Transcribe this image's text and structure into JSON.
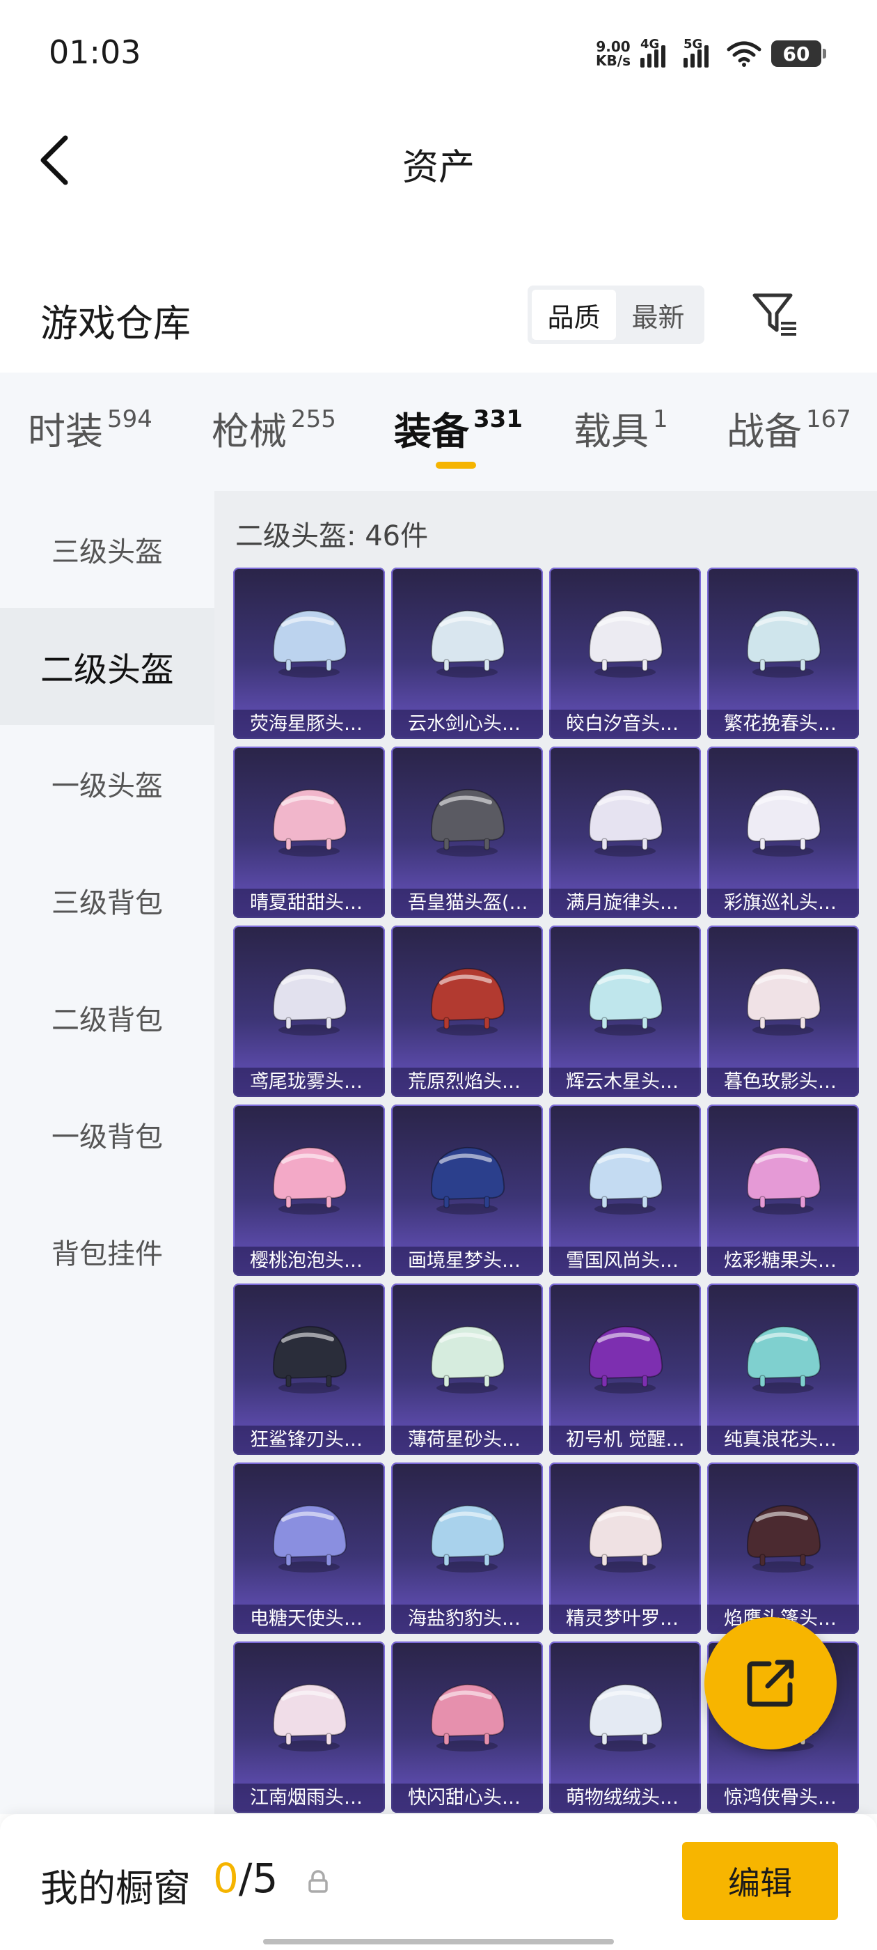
{
  "status": {
    "time": "01:03",
    "netspeed_value": "9.00",
    "netspeed_unit": "KB/s",
    "sig1": "4G",
    "sig2": "5G",
    "battery": "60"
  },
  "nav": {
    "title": "资产"
  },
  "warehouse": {
    "title": "游戏仓库",
    "sort_options": [
      "品质",
      "最新"
    ],
    "sort_selected": "品质"
  },
  "tabs": [
    {
      "label": "时装",
      "count": "594"
    },
    {
      "label": "枪械",
      "count": "255"
    },
    {
      "label": "装备",
      "count": "331",
      "active": true
    },
    {
      "label": "载具",
      "count": "1"
    },
    {
      "label": "战备",
      "count": "167"
    }
  ],
  "sidebar": {
    "items": [
      "三级头盔",
      "二级头盔",
      "一级头盔",
      "三级背包",
      "二级背包",
      "一级背包",
      "背包挂件"
    ],
    "active": "二级头盔"
  },
  "content": {
    "header": "二级头盔: 46件"
  },
  "items": [
    {
      "name": "荧海星豚头…",
      "color": "#bcd3ee"
    },
    {
      "name": "云水剑心头…",
      "color": "#d9e6ef"
    },
    {
      "name": "皎白汐音头…",
      "color": "#ecebf2"
    },
    {
      "name": "繁花挽春头…",
      "color": "#cfe5ec"
    },
    {
      "name": "晴夏甜甜头…",
      "color": "#f1b6cb"
    },
    {
      "name": "吾皇猫头盔(…",
      "color": "#5a5a62"
    },
    {
      "name": "满月旋律头…",
      "color": "#e6e3f1"
    },
    {
      "name": "彩旗巡礼头…",
      "color": "#eeecf5"
    },
    {
      "name": "鸢尾珑雾头…",
      "color": "#e2e1ee"
    },
    {
      "name": "荒原烈焰头…",
      "color": "#b23a30"
    },
    {
      "name": "辉云木星头…",
      "color": "#bfe6ec"
    },
    {
      "name": "暮色玫影头…",
      "color": "#f0e2e6"
    },
    {
      "name": "樱桃泡泡头…",
      "color": "#f3a9c7"
    },
    {
      "name": "画境星梦头…",
      "color": "#2b3f8c"
    },
    {
      "name": "雪国风尚头…",
      "color": "#c4dbf2"
    },
    {
      "name": "炫彩糖果头…",
      "color": "#e59ad6"
    },
    {
      "name": "狂鲨锋刃头…",
      "color": "#2a2d3a"
    },
    {
      "name": "薄荷星砂头…",
      "color": "#d6ecde"
    },
    {
      "name": "初号机 觉醒…",
      "color": "#7d2fb0"
    },
    {
      "name": "纯真浪花头…",
      "color": "#7fd0cf"
    },
    {
      "name": "电糖天使头…",
      "color": "#8a8fe0"
    },
    {
      "name": "海盐豹豹头…",
      "color": "#a9d2ec"
    },
    {
      "name": "精灵梦叶罗…",
      "color": "#efe1e3"
    },
    {
      "name": "焰鹰头篷头…",
      "color": "#4b2a30"
    },
    {
      "name": "江南烟雨头…",
      "color": "#f0dde8"
    },
    {
      "name": "快闪甜心头…",
      "color": "#e690ad"
    },
    {
      "name": "萌物绒绒头…",
      "color": "#e4eaf3"
    },
    {
      "name": "惊鸿侠骨头…",
      "color": "#d8d0c6"
    }
  ],
  "bottom": {
    "label": "我的橱窗",
    "current": "0",
    "total": "/5",
    "edit": "编辑"
  },
  "colors": {
    "accent": "#f7b500",
    "card_border": "#7b6ad8"
  }
}
